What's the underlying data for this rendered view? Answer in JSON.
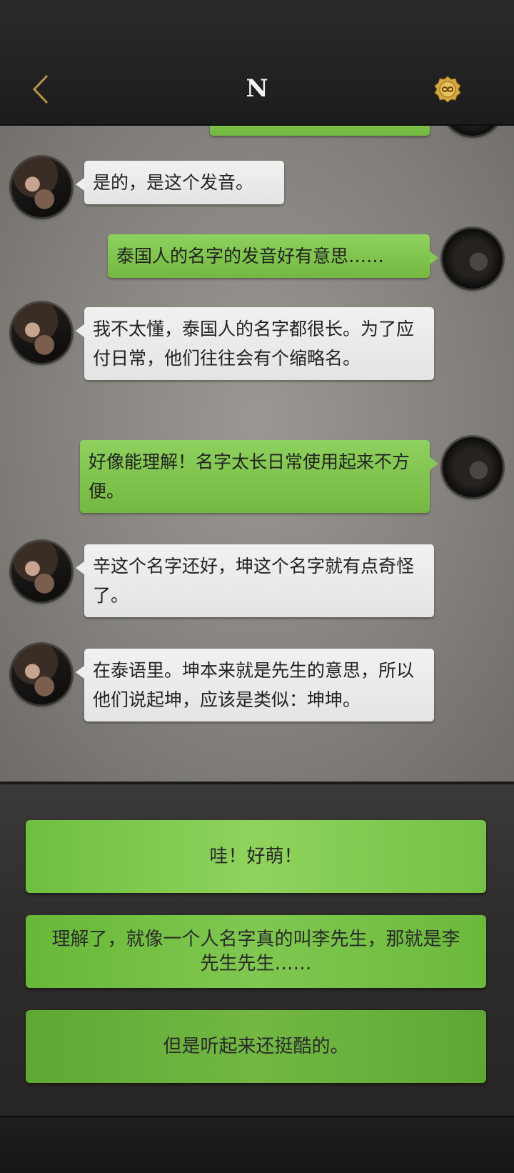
{
  "header": {
    "title": "N",
    "back_icon": "chevron-left-icon",
    "coin_icon": "infinity-coin-icon",
    "accent": "#c9a24a"
  },
  "messages": [
    {
      "from": "me",
      "text": ""
    },
    {
      "from": "other",
      "text": "是的，是这个发音。"
    },
    {
      "from": "me",
      "text": "泰国人的名字的发音好有意思……"
    },
    {
      "from": "other",
      "text": "我不太懂，泰国人的名字都很长。为了应付日常，他们往往会有个缩略名。"
    },
    {
      "from": "me",
      "text": "好像能理解！名字太长日常使用起来不方便。"
    },
    {
      "from": "other",
      "text": "辛这个名字还好，坤这个名字就有点奇怪了。"
    },
    {
      "from": "other",
      "text": "在泰语里。坤本来就是先生的意思，所以他们说起坤，应该是类似：坤坤。"
    }
  ],
  "options": [
    {
      "label": "哇！好萌！"
    },
    {
      "label": "理解了，就像一个人名字真的叫李先生，那就是李先生先生……"
    },
    {
      "label": "但是听起来还挺酷的。"
    }
  ],
  "colors": {
    "bubble_me": "#7fc24f",
    "bubble_other": "#ececec",
    "option_green": "#7cc74b"
  }
}
